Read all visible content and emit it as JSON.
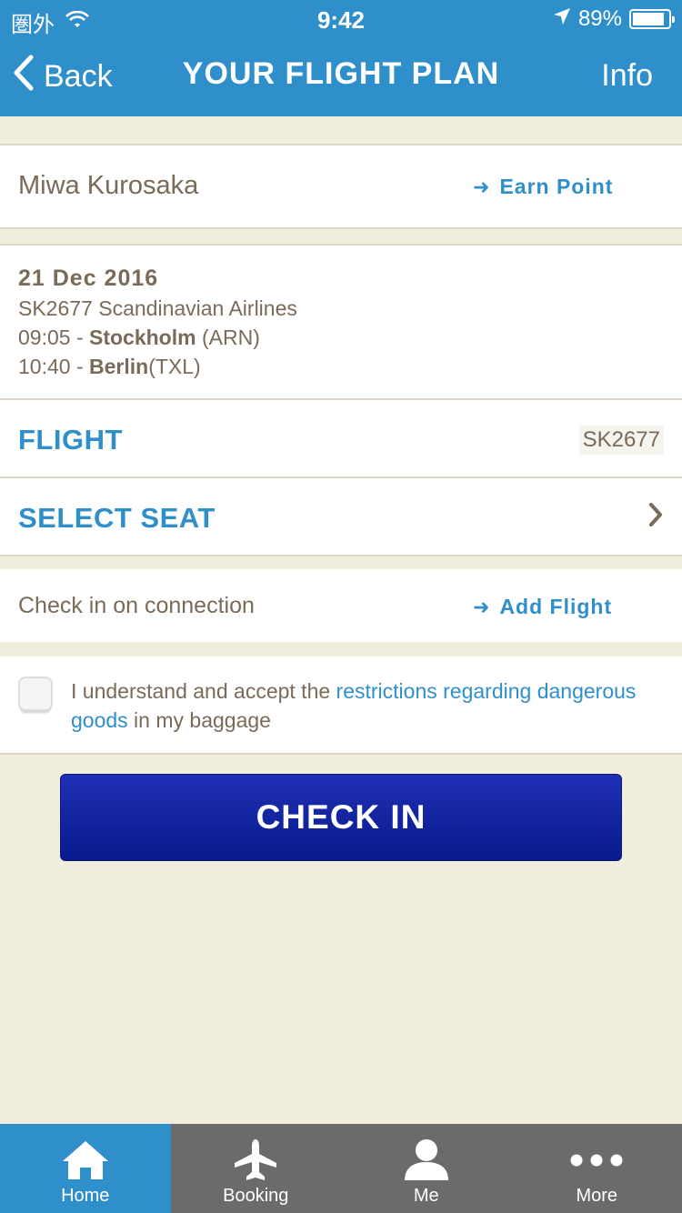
{
  "status_bar": {
    "carrier": "圏外",
    "time": "9:42",
    "battery": "89%",
    "battery_level": 0.89
  },
  "nav": {
    "back_label": "Back",
    "title": "YOUR FLIGHT PLAN",
    "info_label": "Info"
  },
  "passenger": {
    "name": "Miwa Kurosaka",
    "earn_point": "Earn Point"
  },
  "flight_details": {
    "date": "21 Dec 2016",
    "flight_line": "SK2677 Scandinavian Airlines",
    "depart_time": "09:05 - ",
    "depart_city": "Stockholm",
    "depart_code": " (ARN)",
    "arrive_time": "10:40 - ",
    "arrive_city": "Berlin",
    "arrive_code": "(TXL)"
  },
  "flight": {
    "label": "FLIGHT",
    "number": "SK2677"
  },
  "select_seat": {
    "label": "SELECT SEAT"
  },
  "connection": {
    "label": "Check in on connection",
    "add_flight": "Add Flight"
  },
  "agreement": {
    "text_before": "I understand and accept the ",
    "link_text": "restrictions regarding dangerous goods",
    "text_after": " in my baggage"
  },
  "check_in": {
    "label": "CHECK IN"
  },
  "tabbar": {
    "items": [
      {
        "label": "Home",
        "icon": "home-icon"
      },
      {
        "label": "Booking",
        "icon": "airplane-icon"
      },
      {
        "label": "Me",
        "icon": "person-icon"
      },
      {
        "label": "More",
        "icon": "more-dots-icon"
      }
    ],
    "active_index": 0
  },
  "colors": {
    "brand_blue": "#2f8fcb",
    "button_blue": "#081b8c",
    "background": "#f1eee0",
    "tabbar_gray": "#6b6b6b"
  }
}
